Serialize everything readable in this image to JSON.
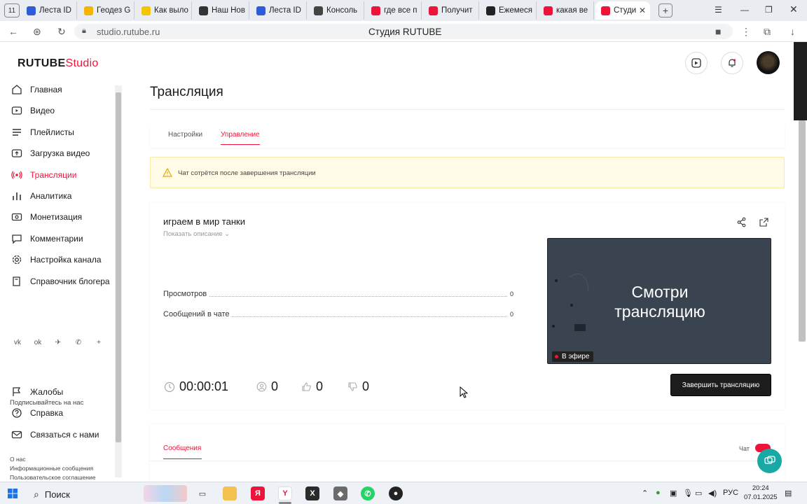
{
  "browser": {
    "tab_counter": "11",
    "tabs": [
      {
        "label": "Леста ID",
        "color": "#2e5bd6"
      },
      {
        "label": "Геодез G",
        "color": "#f4b400"
      },
      {
        "label": "Как выло",
        "color": "#f5c400"
      },
      {
        "label": "Наш Нов",
        "color": "#333333"
      },
      {
        "label": "Леста ID",
        "color": "#2e5bd6"
      },
      {
        "label": "Консоль",
        "color": "#444444"
      },
      {
        "label": "где все п",
        "color": "#ed143b"
      },
      {
        "label": "Получит",
        "color": "#ed143b"
      },
      {
        "label": "Ежемеся",
        "color": "#222222"
      },
      {
        "label": "какая ве",
        "color": "#ed143b"
      },
      {
        "label": "Студи",
        "color": "#ed143b"
      }
    ],
    "new_tab": "+",
    "url": "studio.rutube.ru",
    "page_title": "Студия RUTUBE"
  },
  "studio": {
    "logo_main": "RUTUBE",
    "logo_sub": "Studio",
    "accent": "#ed143b"
  },
  "sidebar": {
    "items": [
      {
        "label": "Главная",
        "icon": "home-icon"
      },
      {
        "label": "Видео",
        "icon": "video-icon"
      },
      {
        "label": "Плейлисты",
        "icon": "playlist-icon"
      },
      {
        "label": "Загрузка видео",
        "icon": "upload-icon"
      },
      {
        "label": "Трансляции",
        "icon": "broadcast-icon"
      },
      {
        "label": "Аналитика",
        "icon": "analytics-icon"
      },
      {
        "label": "Монетизация",
        "icon": "monetization-icon"
      },
      {
        "label": "Комментарии",
        "icon": "comments-icon"
      },
      {
        "label": "Настройка канала",
        "icon": "settings-icon"
      },
      {
        "label": "Справочник блогера",
        "icon": "book-icon"
      }
    ],
    "follow_label": "Подписывайтесь на нас",
    "social": [
      "vk-icon",
      "ok-icon",
      "telegram-icon",
      "viber-icon",
      "plus-icon"
    ],
    "bottom_items": [
      {
        "label": "Жалобы",
        "icon": "flag-icon"
      },
      {
        "label": "Справка",
        "icon": "help-icon"
      },
      {
        "label": "Связаться с нами",
        "icon": "mail-icon"
      }
    ],
    "footer_links": [
      "О нас",
      "Информационные сообщения",
      "Пользовательское соглашение"
    ]
  },
  "main": {
    "title": "Трансляция",
    "tabs": [
      "Настройки",
      "Управление"
    ],
    "warning": "Чат сотрётся после завершения трансляции",
    "stream": {
      "name": "играем в мир танки",
      "show_description": "Показать описание",
      "stats": [
        {
          "label": "Просмотров",
          "value": "0"
        },
        {
          "label": "Сообщений в чате",
          "value": "0"
        }
      ],
      "timer": "00:00:01",
      "viewers": "0",
      "likes": "0",
      "dislikes": "0",
      "preview_text_1": "Смотри",
      "preview_text_2": "трансляцию",
      "live_badge": "В эфире",
      "end_button": "Завершить трансляцию"
    },
    "messages_tab": "Сообщения",
    "chat_label": "Чат",
    "chat_enabled": true
  },
  "taskbar": {
    "search": "Поиск",
    "lang": "РУС",
    "time": "20:24",
    "date": "07.01.2025"
  }
}
